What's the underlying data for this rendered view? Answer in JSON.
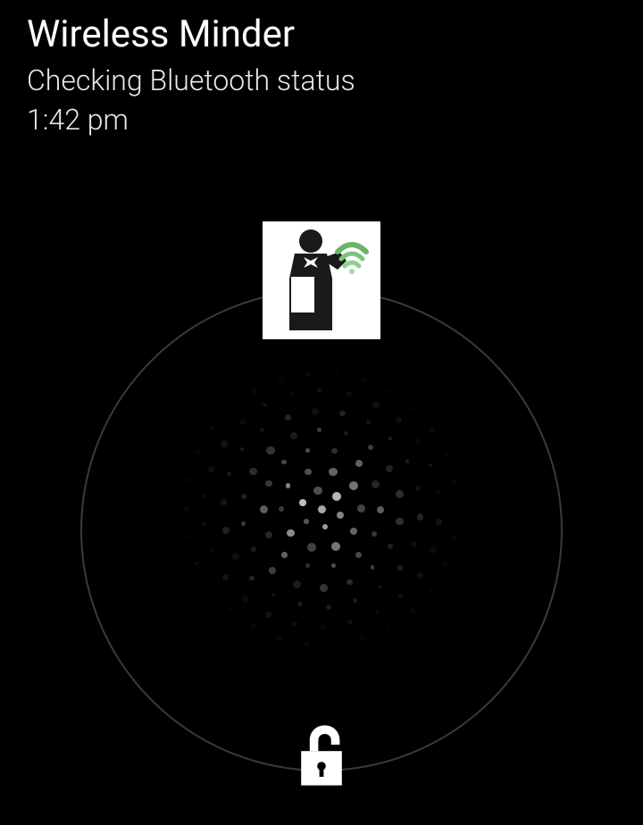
{
  "header": {
    "app_title": "Wireless Minder",
    "status_text": "Checking Bluetooth status",
    "time": "1:42 pm"
  },
  "icons": {
    "app_icon": "butler-wifi-icon",
    "unlock_icon": "unlock-icon"
  },
  "colors": {
    "background": "#000000",
    "text_primary": "#ffffff",
    "text_secondary": "#e8e8e8",
    "ring_border": "#3a3a3a",
    "wifi_signal": "#6bb36b"
  }
}
